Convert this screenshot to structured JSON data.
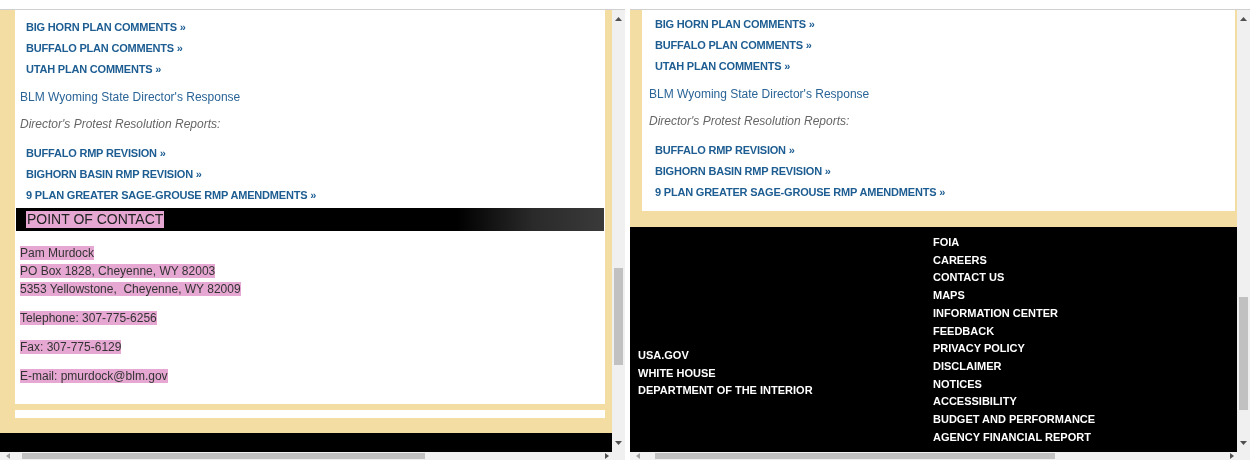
{
  "left_pane": {
    "comment_links": [
      "BIG HORN PLAN COMMENTS »",
      "BUFFALO PLAN COMMENTS »",
      "UTAH PLAN COMMENTS »"
    ],
    "response_link": "BLM Wyoming State Director's Response",
    "protest_label": "Director's Protest Resolution Reports:",
    "protest_links": [
      "BUFFALO RMP REVISION »",
      "BIGHORN BASIN RMP REVISION »",
      "9 PLAN GREATER SAGE-GROUSE RMP AMENDMENTS »"
    ],
    "contact": {
      "heading": {
        "text": "POINT OF CONTACT",
        "highlighted": true
      },
      "groups": [
        {
          "lines": [
            {
              "text": "Pam Murdock",
              "highlighted": true
            },
            {
              "text": "PO Box 1828, Cheyenne, WY 82003",
              "highlighted": true
            },
            {
              "text": "5353 Yellowstone,  Cheyenne, WY 82009",
              "highlighted": true
            }
          ]
        },
        {
          "lines": [
            {
              "text": "Telephone: 307-775-6256",
              "highlighted": true
            }
          ]
        },
        {
          "lines": [
            {
              "text": "Fax: 307-775-6129",
              "highlighted": true
            }
          ]
        },
        {
          "lines": [
            {
              "text": "E-mail: pmurdock@blm.gov",
              "highlighted": true
            }
          ]
        }
      ]
    }
  },
  "right_pane": {
    "comment_links": [
      "BIG HORN PLAN COMMENTS »",
      "BUFFALO PLAN COMMENTS »",
      "UTAH PLAN COMMENTS »"
    ],
    "response_link": "BLM Wyoming State Director's Response",
    "protest_label": "Director's Protest Resolution Reports:",
    "protest_links": [
      "BUFFALO RMP REVISION »",
      "BIGHORN BASIN RMP REVISION »",
      "9 PLAN GREATER SAGE-GROUSE RMP AMENDMENTS »"
    ],
    "footer": {
      "external_links": [
        "USA.GOV",
        "WHITE HOUSE",
        "DEPARTMENT OF THE INTERIOR"
      ],
      "site_links": [
        "FOIA",
        "CAREERS",
        "CONTACT US",
        "MAPS",
        "INFORMATION CENTER",
        "FEEDBACK",
        "PRIVACY POLICY",
        "DISCLAIMER",
        "NOTICES",
        "ACCESSIBILITY",
        "BUDGET AND PERFORMANCE",
        "AGENCY FINANCIAL REPORT"
      ]
    }
  }
}
